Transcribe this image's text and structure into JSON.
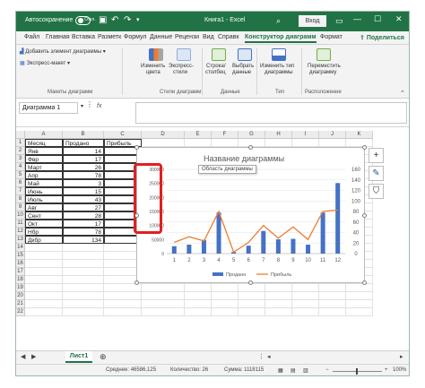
{
  "titlebar": {
    "autosave_label": "Автосохранение",
    "autosave_state": "Откл.",
    "title": "Книга1 - Excel",
    "login_label": "Вход"
  },
  "tabs": [
    "Файл",
    "Главная",
    "Вставка",
    "Разметк",
    "Формул",
    "Данные",
    "Рецензи",
    "Вид",
    "Справк",
    "Конструктор диаграмм",
    "Формат"
  ],
  "active_tab": "Конструктор диаграмм",
  "share_label": "Поделиться",
  "ribbon": {
    "add_element": "Добавить элемент диаграммы",
    "express_layout": "Экспресс-макет",
    "change_colors_1": "Изменить",
    "change_colors_2": "цвета",
    "express_styles_1": "Экспресс-",
    "express_styles_2": "стили",
    "row_col_1": "Строка/",
    "row_col_2": "столбец",
    "select_data_1": "Выбрать",
    "select_data_2": "данные",
    "change_type_1": "Изменить тип",
    "change_type_2": "диаграммы",
    "move_chart_1": "Переместить",
    "move_chart_2": "диаграмму",
    "groups": [
      "Макеты диаграмм",
      "Стили диаграмм",
      "Данные",
      "Тип",
      "Расположение"
    ]
  },
  "formula": {
    "name_box": "Диаграмма 1",
    "fx": "fx"
  },
  "columns": [
    "A",
    "B",
    "C",
    "D",
    "E",
    "F",
    "G",
    "H",
    "I",
    "J",
    "K"
  ],
  "rows": [
    "1",
    "2",
    "3",
    "4",
    "5",
    "6",
    "7",
    "8",
    "9",
    "10",
    "11",
    "12",
    "13",
    "14",
    "15",
    "16",
    "17",
    "18",
    "19",
    "20",
    "21",
    "22"
  ],
  "table": {
    "headers": [
      "Месяц",
      "Продано",
      "Прибыль"
    ],
    "months": [
      "Янв",
      "Фвр",
      "Март",
      "Апр",
      "Май",
      "Июнь",
      "Июль",
      "Авг",
      "Сент",
      "Окт",
      "Нбр",
      "Дкбр"
    ],
    "sold": [
      "14",
      "17",
      "26",
      "78",
      "3",
      "15",
      "43",
      "27",
      "28",
      "17",
      "78",
      "134"
    ]
  },
  "chart": {
    "title": "Название диаграммы",
    "tooltip": "Область диаграммы"
  },
  "chart_data": {
    "type": "bar",
    "categories": [
      "1",
      "2",
      "3",
      "4",
      "5",
      "6",
      "7",
      "8",
      "9",
      "10",
      "11",
      "12"
    ],
    "series": [
      {
        "name": "Продано",
        "type": "bar",
        "axis": "secondary",
        "values": [
          14,
          17,
          26,
          78,
          3,
          15,
          43,
          27,
          28,
          17,
          78,
          134
        ],
        "color": "#4472c4"
      },
      {
        "name": "Прибыль",
        "type": "line",
        "axis": "primary",
        "values": [
          40000,
          60000,
          45000,
          150000,
          5000,
          40000,
          100000,
          55000,
          95000,
          50000,
          150000,
          155000
        ],
        "color": "#ed7d31"
      }
    ],
    "primary_ticks": [
      "300000",
      "250000",
      "200000",
      "150000",
      "100000",
      "50000",
      "0"
    ],
    "secondary_ticks": [
      "160",
      "140",
      "120",
      "100",
      "80",
      "60",
      "40",
      "20",
      "0"
    ],
    "ylim_primary": [
      0,
      300000
    ],
    "ylim_secondary": [
      0,
      160
    ],
    "legend": "bottom",
    "grid": true
  },
  "side_buttons": [
    "+",
    "✎",
    "⛉"
  ],
  "sheet_tab": "Лист1",
  "status": {
    "average": "Среднее: 46586,125",
    "count": "Количество: 26",
    "sum": "Сумма: 1118115",
    "zoom": "100%",
    "minus": "−",
    "plus": "+"
  },
  "colors": {
    "brand": "#217346",
    "bar": "#4472c4",
    "line": "#ed7d31",
    "highlight": "#e02020"
  }
}
